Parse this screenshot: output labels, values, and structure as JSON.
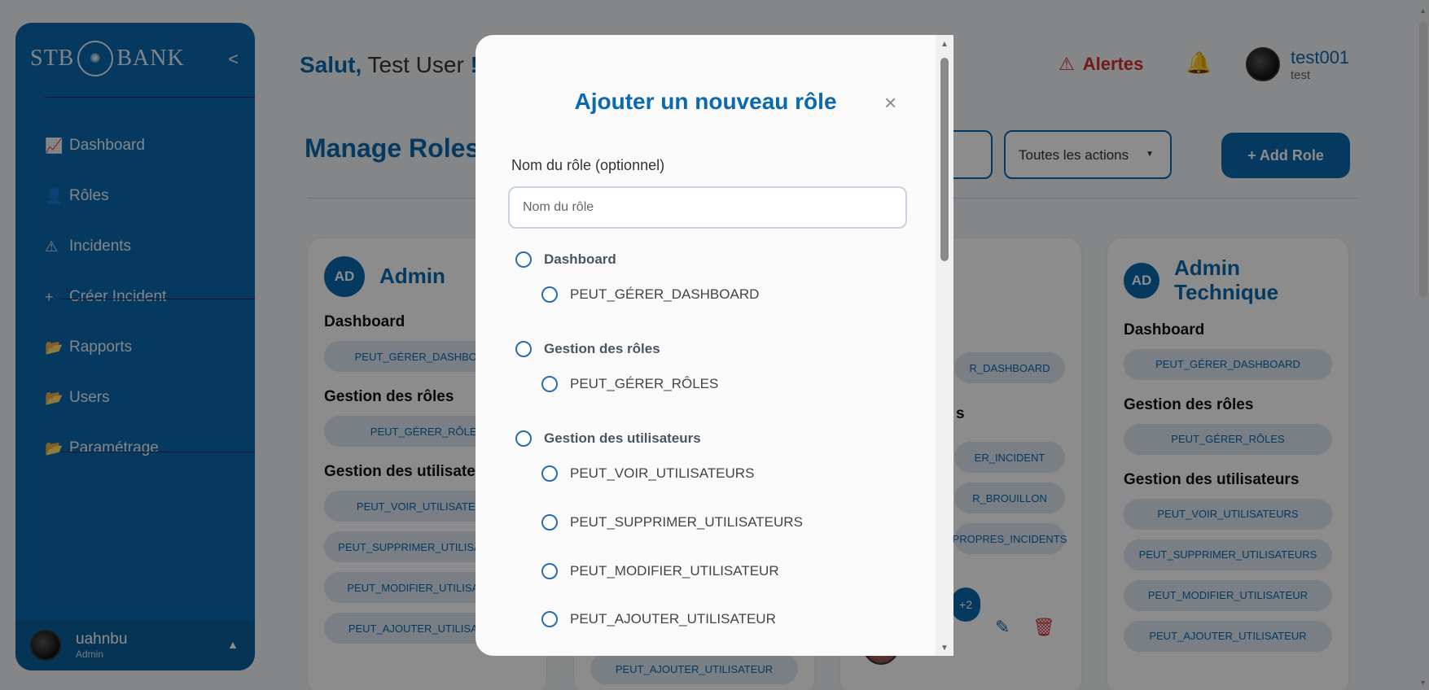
{
  "sidebar": {
    "brand_left": "STB",
    "brand_right": "BANK",
    "collapse_icon": "<",
    "items": [
      {
        "icon": "chart-line-icon",
        "glyph": "📈",
        "label": "Dashboard"
      },
      {
        "icon": "users-gear-icon",
        "glyph": "👤",
        "label": "Rôles"
      },
      {
        "icon": "warning-icon",
        "glyph": "⚠",
        "label": "Incidents"
      },
      {
        "icon": "plus-icon",
        "glyph": "+",
        "label": "Créer Incident"
      },
      {
        "icon": "folder-icon",
        "glyph": "📂",
        "label": "Rapports"
      },
      {
        "icon": "folder-icon",
        "glyph": "📂",
        "label": "Users"
      },
      {
        "icon": "folder-icon",
        "glyph": "📂",
        "label": "Paramétrage"
      }
    ],
    "user": {
      "name": "uahnbu",
      "role": "Admin"
    }
  },
  "header": {
    "greeting": "Salut,",
    "user_name": "Test User",
    "exclaim": "!",
    "alerts_label": "Alertes",
    "profile_name": "test001",
    "profile_sub": "test"
  },
  "main": {
    "title": "Manage Roles",
    "actions_filter": "Toutes les actions",
    "add_role_label": "+ Add Role"
  },
  "cards": [
    {
      "initials": "AD",
      "title": "Admin",
      "sections": [
        {
          "title": "Dashboard",
          "perms": [
            "PEUT_GÉRER_DASHBOARD"
          ]
        },
        {
          "title": "Gestion des rôles",
          "perms": [
            "PEUT_GÉRER_RÔLES"
          ]
        },
        {
          "title": "Gestion des utilisateurs",
          "perms": [
            "PEUT_VOIR_UTILISATEURS",
            "PEUT_SUPPRIMER_UTILISATEURS",
            "PEUT_MODIFIER_UTILISATEUR",
            "PEUT_AJOUTER_UTILISATEUR"
          ]
        }
      ]
    },
    {
      "initials": "AD",
      "title": "Admin Technique",
      "sections": [
        {
          "title": "Dashboard",
          "perms": [
            "PEUT_GÉRER_DASHBOARD"
          ]
        },
        {
          "title": "Gestion des rôles",
          "perms": [
            "PEUT_GÉRER_RÔLES"
          ]
        },
        {
          "title": "Gestion des utilisateurs",
          "perms": [
            "PEUT_VOIR_UTILISATEURS",
            "PEUT_SUPPRIMER_UTILISATEURS",
            "PEUT_MODIFIER_UTILISATEUR",
            "PEUT_AJOUTER_UTILISATEUR"
          ]
        }
      ]
    }
  ],
  "card2_partial": {
    "last_pill": "PEUT_AJOUTER_UTILISATEUR"
  },
  "card3_partial": {
    "pills": [
      "R_DASHBOARD",
      "ER_INCIDENT",
      "R_BROUILLON",
      "PROPRES_INCIDENTS"
    ],
    "section_tail": "s",
    "more_count": "+2"
  },
  "modal": {
    "title": "Ajouter un nouveau rôle",
    "close": "×",
    "name_label": "Nom du rôle (optionnel)",
    "name_placeholder": "Nom du rôle",
    "name_value": "",
    "groups": [
      {
        "label": "Dashboard",
        "perms": [
          "PEUT_GÉRER_DASHBOARD"
        ]
      },
      {
        "label": "Gestion des rôles",
        "perms": [
          "PEUT_GÉRER_RÔLES"
        ]
      },
      {
        "label": "Gestion des utilisateurs",
        "perms": [
          "PEUT_VOIR_UTILISATEURS",
          "PEUT_SUPPRIMER_UTILISATEURS",
          "PEUT_MODIFIER_UTILISATEUR",
          "PEUT_AJOUTER_UTILISATEUR"
        ]
      }
    ]
  },
  "colors": {
    "primary": "#0b69ad",
    "danger": "#d32f2f",
    "pill_bg": "#dde8f3"
  }
}
